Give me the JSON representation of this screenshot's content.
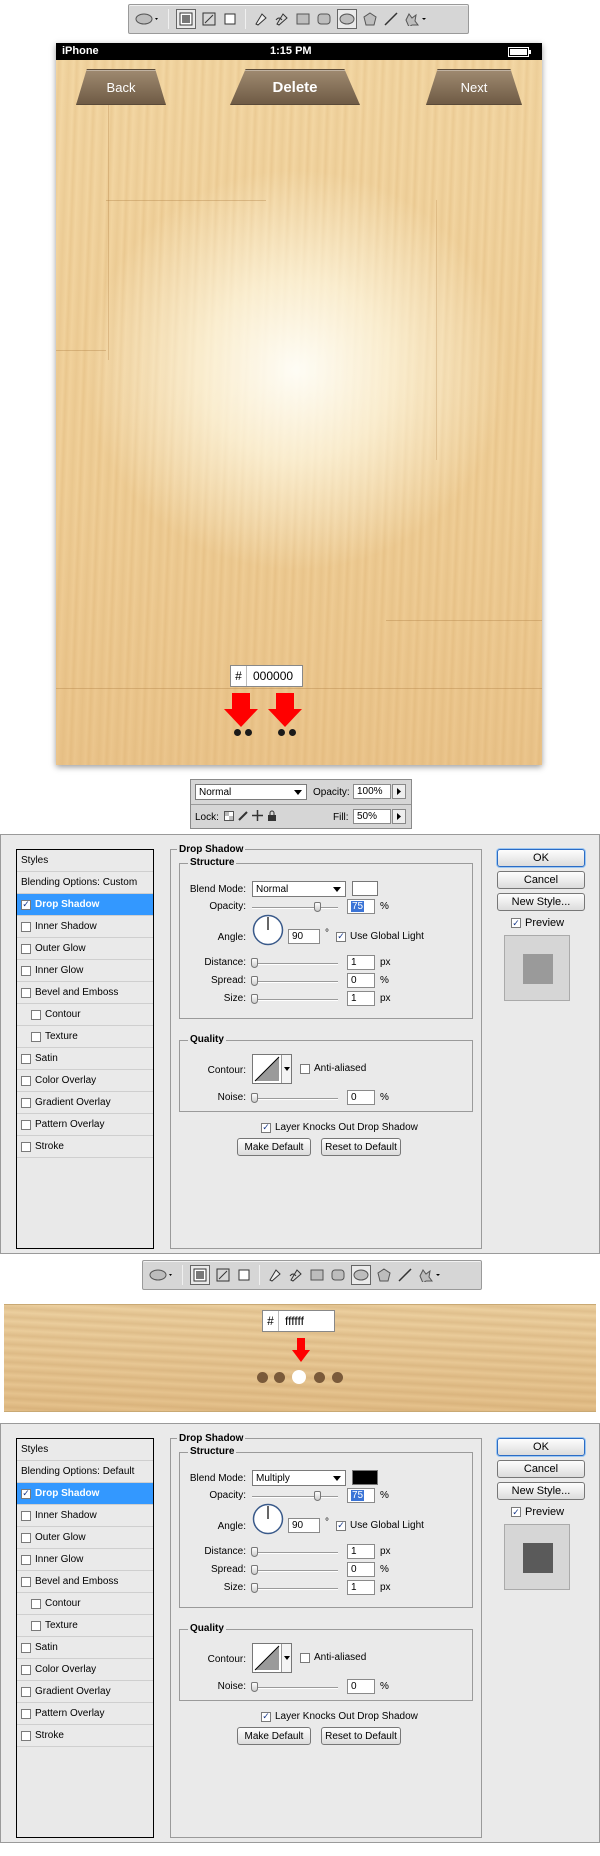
{
  "status_bar": {
    "carrier": "iPhone",
    "time": "1:15 PM"
  },
  "nav": {
    "back": "Back",
    "title": "Delete",
    "next": "Next"
  },
  "hex_top": {
    "hash": "#",
    "value": "000000"
  },
  "hex_strip": {
    "hash": "#",
    "value": "ffffff"
  },
  "layers": {
    "blend": "Normal",
    "opacity_label": "Opacity:",
    "opacity": "100%",
    "lock_label": "Lock:",
    "fill_label": "Fill:",
    "fill": "50%"
  },
  "style_list": [
    "Inner Shadow",
    "Outer Glow",
    "Inner Glow",
    "Bevel and Emboss",
    "Contour",
    "Texture",
    "Satin",
    "Color Overlay",
    "Gradient Overlay",
    "Pattern Overlay",
    "Stroke"
  ],
  "dialog1": {
    "styles_title": "Styles",
    "blending": "Blending Options: Custom",
    "active": "Drop Shadow",
    "section": "Drop Shadow",
    "structure": "Structure",
    "blend_mode_label": "Blend Mode:",
    "blend_mode": "Normal",
    "swatch_color": "#ffffff",
    "opacity_label": "Opacity:",
    "opacity": "75",
    "angle_label": "Angle:",
    "angle": "90",
    "global_light": "Use Global Light",
    "distance_label": "Distance:",
    "distance": "1",
    "spread_label": "Spread:",
    "spread": "0",
    "size_label": "Size:",
    "size": "1",
    "quality": "Quality",
    "contour_label": "Contour:",
    "anti_aliased": "Anti-aliased",
    "noise_label": "Noise:",
    "noise": "0",
    "knockout": "Layer Knocks Out Drop Shadow",
    "make_default": "Make Default",
    "reset_default": "Reset to Default",
    "ok": "OK",
    "cancel": "Cancel",
    "new_style": "New Style...",
    "preview": "Preview",
    "preview_color": "#9a9a9a"
  },
  "dialog2": {
    "styles_title": "Styles",
    "blending": "Blending Options: Default",
    "active": "Drop Shadow",
    "section": "Drop Shadow",
    "structure": "Structure",
    "blend_mode_label": "Blend Mode:",
    "blend_mode": "Multiply",
    "swatch_color": "#000000",
    "opacity_label": "Opacity:",
    "opacity": "75",
    "angle_label": "Angle:",
    "angle": "90",
    "global_light": "Use Global Light",
    "distance_label": "Distance:",
    "distance": "1",
    "spread_label": "Spread:",
    "spread": "0",
    "size_label": "Size:",
    "size": "1",
    "quality": "Quality",
    "contour_label": "Contour:",
    "anti_aliased": "Anti-aliased",
    "noise_label": "Noise:",
    "noise": "0",
    "knockout": "Layer Knocks Out Drop Shadow",
    "make_default": "Make Default",
    "reset_default": "Reset to Default",
    "ok": "OK",
    "cancel": "Cancel",
    "new_style": "New Style...",
    "preview": "Preview",
    "preview_color": "#5a5a5a"
  },
  "units": {
    "percent": "%",
    "degree": "°",
    "px": "px"
  },
  "colors": {
    "accent": "#3398ff",
    "arrow": "#ff0000",
    "dot_dark": "#1a1a1a",
    "dot_strip": "#7a5a3a"
  }
}
